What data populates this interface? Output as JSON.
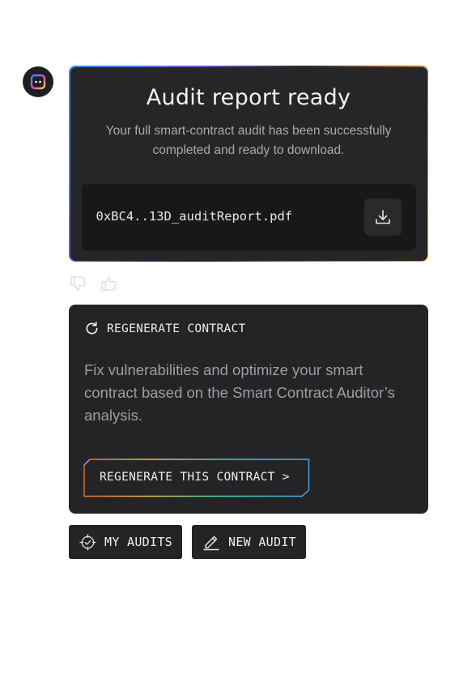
{
  "report": {
    "title": "Audit report ready",
    "subtitle": "Your full smart-contract audit has been successfully completed and ready to download.",
    "file_name": "0xBC4..13D_auditReport.pdf"
  },
  "regenerate": {
    "header_label": "REGENERATE CONTRACT",
    "description": "Fix vulnerabilities and optimize your smart contract based on the Smart Contract Auditor’s analysis.",
    "button_label": "REGENERATE THIS CONTRACT >"
  },
  "actions": {
    "my_audits_label": "MY AUDITS",
    "new_audit_label": "NEW AUDIT"
  },
  "icons": {
    "avatar": "bot-avatar-icon",
    "download": "download-icon",
    "thumb_down": "thumbs-down-icon",
    "thumb_up": "thumbs-up-icon",
    "regenerate": "refresh-icon",
    "my_audits": "target-check-icon",
    "new_audit": "pencil-icon"
  },
  "colors": {
    "card_bg": "#262628",
    "file_row_bg": "#18181a",
    "text_primary": "#f2f2f2",
    "text_muted": "#a9a9ad",
    "gradient_blue": "#2f8cf0",
    "gradient_orange": "#f0a030"
  }
}
